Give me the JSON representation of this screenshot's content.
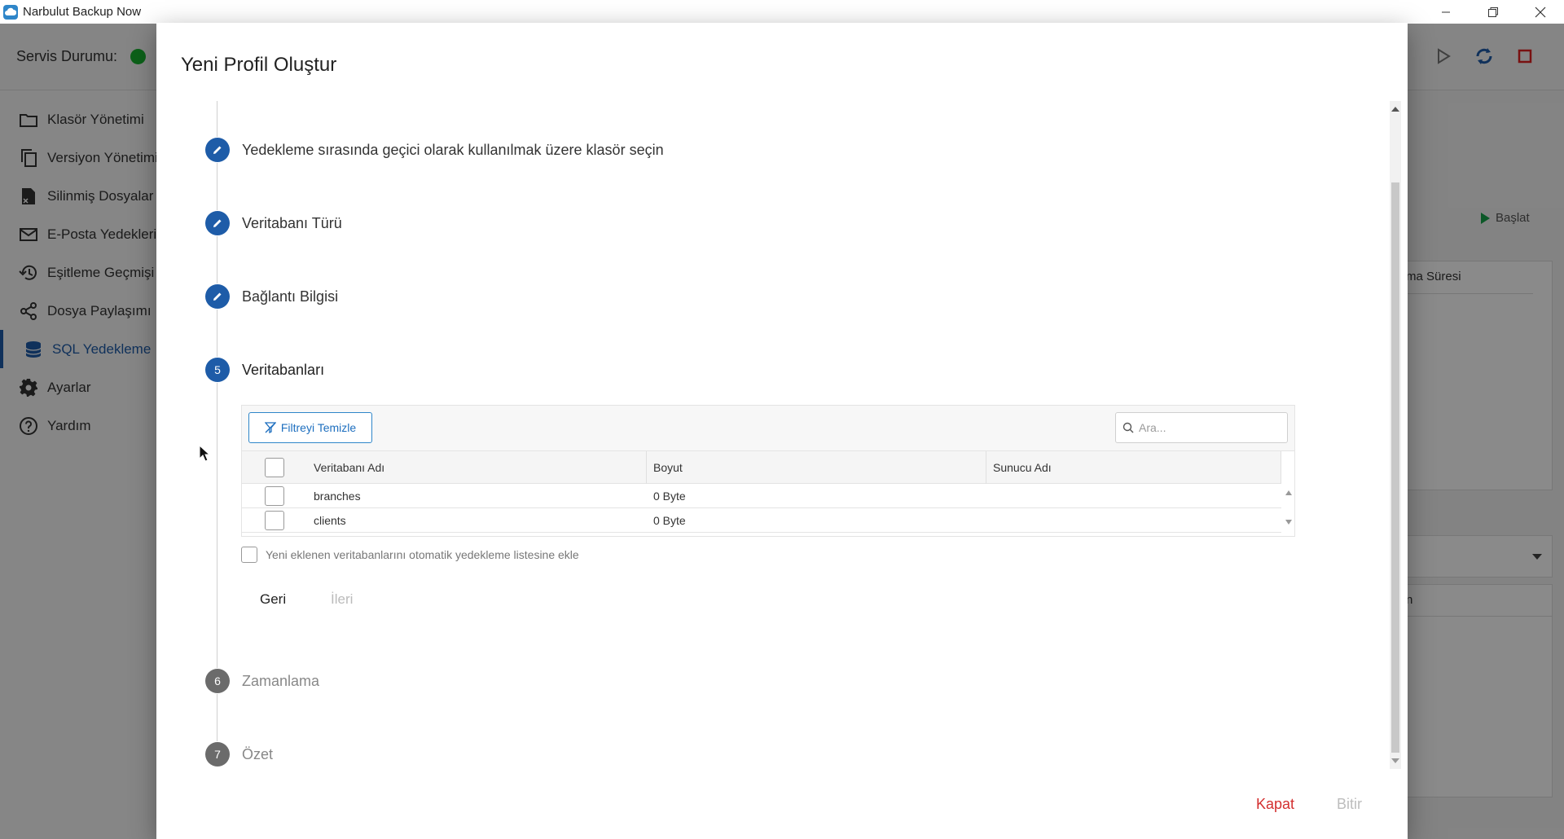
{
  "window": {
    "title": "Narbulut Backup Now",
    "controls": [
      "minimize-icon",
      "restore-icon",
      "close-icon"
    ]
  },
  "header": {
    "service_status_label": "Servis Durumu:",
    "service_status_color": "#17b12f",
    "actions": [
      "play-icon",
      "sync-icon",
      "stop-icon"
    ]
  },
  "sidebar": {
    "items": [
      {
        "label": "Klasör Yönetimi",
        "icon": "folder-icon"
      },
      {
        "label": "Versiyon Yönetimi",
        "icon": "copy-icon"
      },
      {
        "label": "Silinmiş Dosyalar",
        "icon": "deleted-file-icon"
      },
      {
        "label": "E-Posta Yedekleri",
        "icon": "mail-icon"
      },
      {
        "label": "Eşitleme Geçmişi",
        "icon": "history-icon"
      },
      {
        "label": "Dosya Paylaşımı",
        "icon": "share-icon"
      },
      {
        "label": "SQL Yedekleme",
        "icon": "database-icon",
        "active": true
      },
      {
        "label": "Ayarlar",
        "icon": "gear-icon"
      },
      {
        "label": "Yardım",
        "icon": "help-icon"
      }
    ]
  },
  "background": {
    "start_label": "Başlat",
    "column_partial": "ma Süresi",
    "column2_partial": "n"
  },
  "dialog": {
    "title": "Yeni Profil Oluştur",
    "steps": [
      {
        "number": "",
        "label": "Yedekleme sırasında geçici olarak kullanılmak üzere klasör seçin",
        "state": "done"
      },
      {
        "number": "",
        "label": "Veritabanı Türü",
        "state": "done"
      },
      {
        "number": "",
        "label": "Bağlantı Bilgisi",
        "state": "done"
      },
      {
        "number": "5",
        "label": "Veritabanları",
        "state": "active"
      },
      {
        "number": "6",
        "label": "Zamanlama",
        "state": "future"
      },
      {
        "number": "7",
        "label": "Özet",
        "state": "future"
      }
    ],
    "table": {
      "clear_filter_label": "Filtreyi Temizle",
      "search_placeholder": "Ara...",
      "columns": [
        "Veritabanı Adı",
        "Boyut",
        "Sunucu Adı"
      ],
      "rows": [
        {
          "name": "branches",
          "size": "0 Byte",
          "host": ""
        },
        {
          "name": "clients",
          "size": "0 Byte",
          "host": ""
        }
      ]
    },
    "auto_add_label": "Yeni eklenen veritabanlarını otomatik yedekleme listesine ekle",
    "back_label": "Geri",
    "next_label": "İleri",
    "close_label": "Kapat",
    "finish_label": "Bitir",
    "accent_color": "#1e5ca8",
    "close_color": "#d32f2f"
  }
}
